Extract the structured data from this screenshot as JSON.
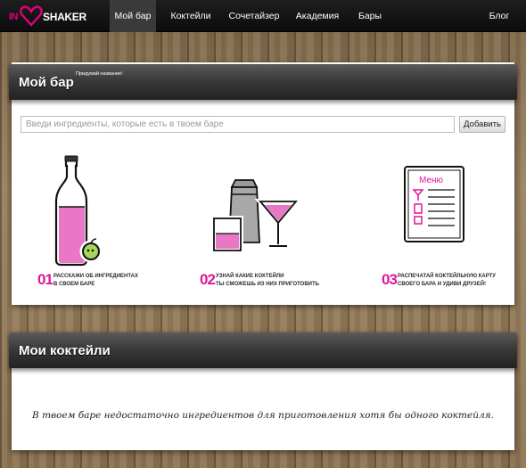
{
  "nav": {
    "logo_in": "IN",
    "logo_shaker": "SHAKER",
    "items": [
      {
        "label": "Мой бар"
      },
      {
        "label": "Коктейли"
      },
      {
        "label": "Сочетайзер"
      },
      {
        "label": "Академия"
      },
      {
        "label": "Бары"
      },
      {
        "label": "Блог"
      }
    ],
    "active_item": "Мой бар"
  },
  "my_bar": {
    "title": "Мой бар",
    "hint": "Придумай название!",
    "search_placeholder": "Введи ингредиенты, которые есть в твоем баре",
    "add_button": "Добавить",
    "steps": [
      {
        "num": "01",
        "line1": "РАССКАЖИ ОБ ИНГРЕДИЕНТАХ",
        "line2": "В СВОЕМ БАРЕ"
      },
      {
        "num": "02",
        "line1": "УЗНАЙ КАКИЕ КОКТЕЙЛИ",
        "line2": "ТЫ СМОЖЕШЬ ИЗ НИХ ПРИГОТОВИТЬ"
      },
      {
        "num": "03",
        "line1": "РАСПЕЧАТАЙ КОКТЕЙЛЬНУЮ КАРТУ",
        "line2": "СВОЕГО БАРА И УДИВИ ДРУЗЕЙ!"
      }
    ],
    "menu_card_title": "Меню"
  },
  "my_cocktails": {
    "title": "Мои коктейли",
    "empty_message": "В твоем баре недостаточно ингредиентов для приготовления хотя бы одного коктейля."
  },
  "colors": {
    "accent": "#e0169a",
    "navbar": "#111111",
    "panel_header": "#3a3a3a"
  }
}
